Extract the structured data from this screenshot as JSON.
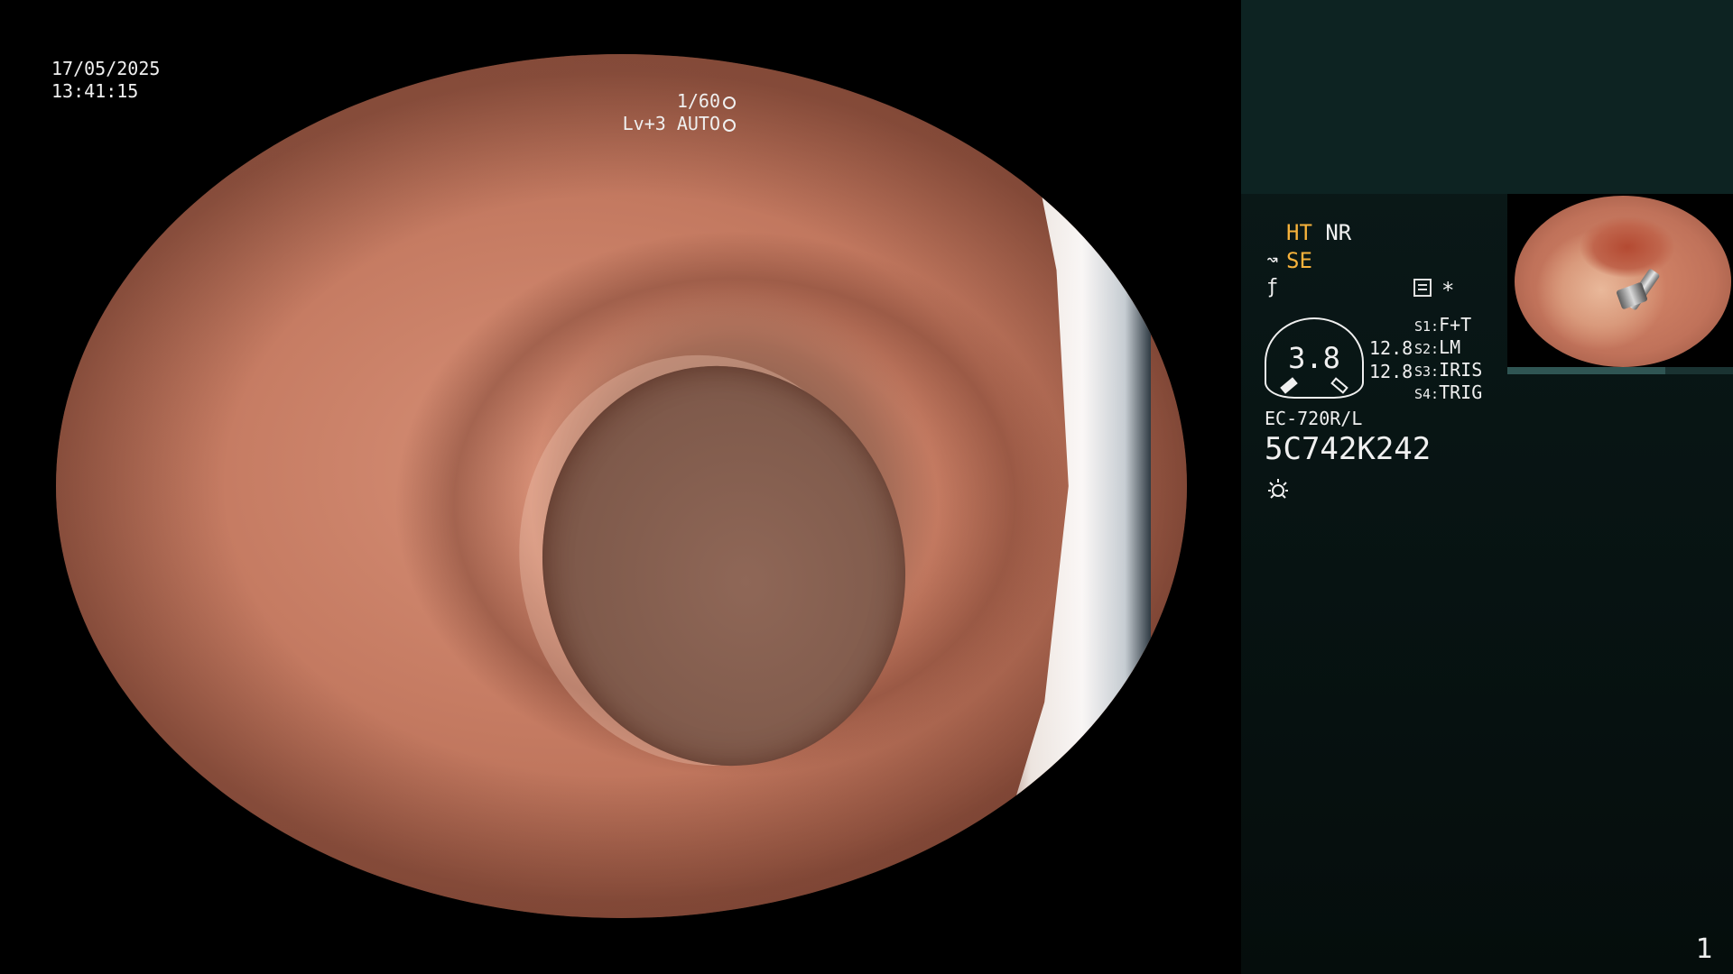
{
  "osd": {
    "date": "17/05/2025",
    "time": "13:41:15",
    "shutter": "1/60",
    "level": "Lv+3 AUTO"
  },
  "panel": {
    "mode_ht": "HT",
    "mode_nr": "NR",
    "mode_se": "SE",
    "star": "*",
    "gauge_value": "3.8",
    "gauge_value_1": "12.8",
    "gauge_value_2": "12.8",
    "switches": [
      {
        "key": "S1:",
        "value": "F+T"
      },
      {
        "key": "S2:",
        "value": "LM"
      },
      {
        "key": "S3:",
        "value": "IRIS"
      },
      {
        "key": "S4:",
        "value": "TRIG"
      }
    ],
    "model": "EC-720R/L",
    "serial": "5C742K242",
    "page": "1"
  },
  "icons": {
    "shutter": "aperture-icon",
    "level": "iris-icon",
    "wave": "wave-icon",
    "enhance": "enhance-icon",
    "memory": "memory-icon",
    "light": "light-icon"
  },
  "colors": {
    "accent": "#f7b23b",
    "panel_bg": "#0b1a1a"
  }
}
